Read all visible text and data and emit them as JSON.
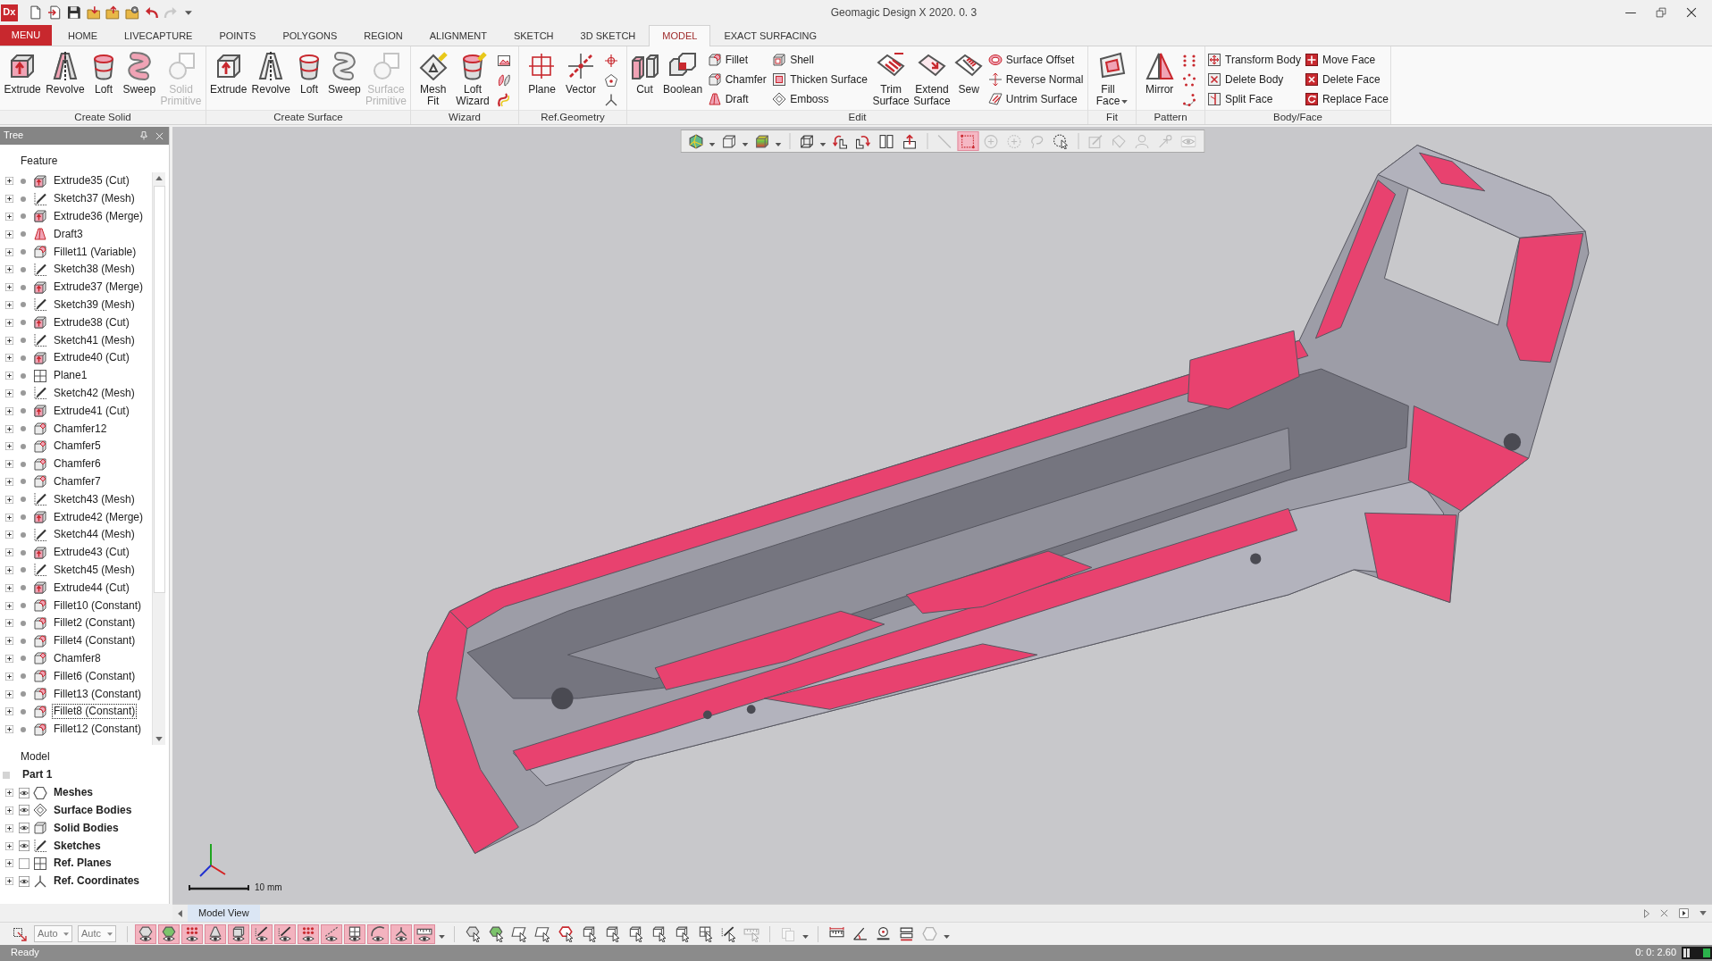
{
  "window": {
    "title": "Geomagic Design X 2020. 0. 3"
  },
  "app_logo": "Dx",
  "quick_access": [
    {
      "disabled": false
    },
    {
      "disabled": false
    },
    {
      "disabled": false
    },
    {
      "disabled": false
    },
    {
      "disabled": false
    },
    {
      "disabled": false
    },
    {
      "disabled": false
    },
    {
      "disabled": true
    }
  ],
  "menu_button": {
    "label": "MENU"
  },
  "tabs": [
    {
      "label": "HOME",
      "selected": false
    },
    {
      "label": "LIVECAPTURE",
      "selected": false
    },
    {
      "label": "POINTS",
      "selected": false
    },
    {
      "label": "POLYGONS",
      "selected": false
    },
    {
      "label": "REGION",
      "selected": false
    },
    {
      "label": "ALIGNMENT",
      "selected": false
    },
    {
      "label": "SKETCH",
      "selected": false
    },
    {
      "label": "3D SKETCH",
      "selected": false
    },
    {
      "label": "MODEL",
      "selected": true
    },
    {
      "label": "EXACT SURFACING",
      "selected": false
    }
  ],
  "ribbon": {
    "groups": [
      {
        "title": "Create Solid",
        "tools": [
          {
            "kind": "large",
            "label": "Extrude",
            "disabled": false
          },
          {
            "kind": "large",
            "label": "Revolve",
            "disabled": false
          },
          {
            "kind": "large",
            "label": "Loft",
            "disabled": false
          },
          {
            "kind": "large",
            "label": "Sweep",
            "disabled": false
          },
          {
            "kind": "large",
            "label": "Solid Primitive",
            "disabled": true
          }
        ]
      },
      {
        "title": "Create Surface",
        "tools": [
          {
            "kind": "large",
            "label": "Extrude",
            "disabled": false
          },
          {
            "kind": "large",
            "label": "Revolve",
            "disabled": false
          },
          {
            "kind": "large",
            "label": "Loft",
            "disabled": false
          },
          {
            "kind": "large",
            "label": "Sweep",
            "disabled": false
          },
          {
            "kind": "large",
            "label": "Surface Primitive",
            "disabled": true
          }
        ]
      },
      {
        "title": "Wizard",
        "tools": [
          {
            "kind": "large",
            "label": "Mesh Fit",
            "disabled": false
          },
          {
            "kind": "large",
            "label": "Loft Wizard",
            "disabled": false
          },
          {
            "kind": "icon_stack"
          }
        ]
      },
      {
        "title": "Ref.Geometry",
        "tools": [
          {
            "kind": "large",
            "label": "Plane",
            "disabled": false
          },
          {
            "kind": "large",
            "label": "Vector",
            "disabled": false
          },
          {
            "kind": "icon_stack"
          }
        ]
      },
      {
        "title": "Edit",
        "tools": [
          {
            "kind": "large",
            "label": "Cut",
            "disabled": false
          },
          {
            "kind": "large",
            "label": "Boolean",
            "disabled": false
          },
          {
            "kind": "small_column",
            "items": [
              {
                "label": "Fillet"
              },
              {
                "label": "Chamfer"
              },
              {
                "label": "Draft"
              }
            ]
          },
          {
            "kind": "small_column",
            "items": [
              {
                "label": "Shell"
              },
              {
                "label": "Thicken Surface"
              },
              {
                "label": "Emboss"
              }
            ]
          },
          {
            "kind": "large",
            "label": "Trim Surface",
            "disabled": false
          },
          {
            "kind": "large",
            "label": "Extend Surface",
            "disabled": false
          },
          {
            "kind": "large",
            "label": "Sew",
            "disabled": false
          },
          {
            "kind": "small_column",
            "items": [
              {
                "label": "Surface Offset"
              },
              {
                "label": "Reverse Normal"
              },
              {
                "label": "Untrim Surface"
              }
            ]
          }
        ]
      },
      {
        "title": "Fit",
        "tools": [
          {
            "kind": "large",
            "label": "Fill Face",
            "disabled": false,
            "dropdown": true
          }
        ]
      },
      {
        "title": "Pattern",
        "tools": [
          {
            "kind": "large",
            "label": "Mirror",
            "disabled": false
          },
          {
            "kind": "icon_stack"
          }
        ]
      },
      {
        "title": "Body/Face",
        "tools": [
          {
            "kind": "small_column",
            "items": [
              {
                "label": "Transform Body"
              },
              {
                "label": "Delete Body"
              },
              {
                "label": "Split Face"
              }
            ]
          },
          {
            "kind": "small_column",
            "items": [
              {
                "label": "Move Face"
              },
              {
                "label": "Delete Face"
              },
              {
                "label": "Replace Face"
              }
            ]
          }
        ]
      }
    ]
  },
  "tree_panel": {
    "title": "Tree",
    "features_heading": "Feature",
    "features": [
      {
        "kind": "extrude",
        "label": "Extrude35 (Cut)",
        "expanded": false,
        "selected": false
      },
      {
        "kind": "sketch",
        "label": "Sketch37 (Mesh)",
        "expanded": false,
        "selected": false
      },
      {
        "kind": "extrude",
        "label": "Extrude36 (Merge)",
        "expanded": false,
        "selected": false
      },
      {
        "kind": "draft",
        "label": "Draft3",
        "expanded": false,
        "selected": false
      },
      {
        "kind": "fillet",
        "label": "Fillet11 (Variable)",
        "expanded": false,
        "selected": false
      },
      {
        "kind": "sketch",
        "label": "Sketch38 (Mesh)",
        "expanded": false,
        "selected": false
      },
      {
        "kind": "extrude",
        "label": "Extrude37 (Merge)",
        "expanded": false,
        "selected": false
      },
      {
        "kind": "sketch",
        "label": "Sketch39 (Mesh)",
        "expanded": false,
        "selected": false
      },
      {
        "kind": "extrude",
        "label": "Extrude38 (Cut)",
        "expanded": false,
        "selected": false
      },
      {
        "kind": "sketch",
        "label": "Sketch41 (Mesh)",
        "expanded": false,
        "selected": false
      },
      {
        "kind": "extrude",
        "label": "Extrude40 (Cut)",
        "expanded": false,
        "selected": false
      },
      {
        "kind": "plane",
        "label": "Plane1",
        "expanded": false,
        "selected": false
      },
      {
        "kind": "sketch",
        "label": "Sketch42 (Mesh)",
        "expanded": false,
        "selected": false
      },
      {
        "kind": "extrude",
        "label": "Extrude41 (Cut)",
        "expanded": false,
        "selected": false
      },
      {
        "kind": "chamfer",
        "label": "Chamfer12",
        "expanded": false,
        "selected": false
      },
      {
        "kind": "chamfer",
        "label": "Chamfer5",
        "expanded": false,
        "selected": false
      },
      {
        "kind": "chamfer",
        "label": "Chamfer6",
        "expanded": false,
        "selected": false
      },
      {
        "kind": "chamfer",
        "label": "Chamfer7",
        "expanded": false,
        "selected": false
      },
      {
        "kind": "sketch",
        "label": "Sketch43 (Mesh)",
        "expanded": false,
        "selected": false
      },
      {
        "kind": "extrude",
        "label": "Extrude42 (Merge)",
        "expanded": false,
        "selected": false
      },
      {
        "kind": "sketch",
        "label": "Sketch44 (Mesh)",
        "expanded": false,
        "selected": false
      },
      {
        "kind": "extrude",
        "label": "Extrude43 (Cut)",
        "expanded": false,
        "selected": false
      },
      {
        "kind": "sketch",
        "label": "Sketch45 (Mesh)",
        "expanded": false,
        "selected": false
      },
      {
        "kind": "extrude",
        "label": "Extrude44 (Cut)",
        "expanded": false,
        "selected": false
      },
      {
        "kind": "fillet",
        "label": "Fillet10 (Constant)",
        "expanded": false,
        "selected": false
      },
      {
        "kind": "fillet",
        "label": "Fillet2 (Constant)",
        "expanded": false,
        "selected": false
      },
      {
        "kind": "fillet",
        "label": "Fillet4 (Constant)",
        "expanded": false,
        "selected": false
      },
      {
        "kind": "chamfer",
        "label": "Chamfer8",
        "expanded": false,
        "selected": false
      },
      {
        "kind": "fillet",
        "label": "Fillet6 (Constant)",
        "expanded": false,
        "selected": false
      },
      {
        "kind": "fillet",
        "label": "Fillet13 (Constant)",
        "expanded": false,
        "selected": false
      },
      {
        "kind": "fillet",
        "label": "Fillet8 (Constant)",
        "expanded": false,
        "selected": true
      },
      {
        "kind": "fillet",
        "label": "Fillet12 (Constant)",
        "expanded": false,
        "selected": false
      }
    ],
    "model_heading": "Model",
    "model_root": {
      "label": "Part 1",
      "children": [
        {
          "kind": "meshes",
          "label": "Meshes",
          "visible": true,
          "expanded": false
        },
        {
          "kind": "surface_bodies",
          "label": "Surface Bodies",
          "visible": true,
          "expanded": false
        },
        {
          "kind": "solid_bodies",
          "label": "Solid Bodies",
          "visible": true,
          "expanded": false
        },
        {
          "kind": "sketches",
          "label": "Sketches",
          "visible": true,
          "expanded": false
        },
        {
          "kind": "ref_planes",
          "label": "Ref. Planes",
          "visible": false,
          "expanded": false
        },
        {
          "kind": "ref_coordinates",
          "label": "Ref. Coordinates",
          "visible": true,
          "expanded": false
        }
      ]
    }
  },
  "viewport": {
    "tools": [
      {
        "on": false,
        "disabled": false,
        "dropdown": true
      },
      {
        "on": false,
        "disabled": false,
        "dropdown": true
      },
      {
        "on": false,
        "disabled": false,
        "dropdown": true
      },
      {
        "on": false,
        "disabled": false,
        "dropdown": true
      },
      {
        "on": false,
        "disabled": false
      },
      {
        "on": false,
        "disabled": false
      },
      {
        "on": false,
        "disabled": false
      },
      {
        "on": false,
        "disabled": false
      },
      {
        "on": false,
        "disabled": true
      },
      {
        "on": true,
        "disabled": false
      },
      {
        "on": false,
        "disabled": true
      },
      {
        "on": false,
        "disabled": true
      },
      {
        "on": false,
        "disabled": true
      },
      {
        "on": false,
        "disabled": false
      },
      {
        "on": false,
        "disabled": true
      },
      {
        "on": false,
        "disabled": true
      },
      {
        "on": false,
        "disabled": true
      },
      {
        "on": false,
        "disabled": true
      },
      {
        "on": false,
        "disabled": true
      }
    ],
    "scale_label": "10 mm"
  },
  "view_tabs": [
    {
      "label": "Model View",
      "selected": true
    }
  ],
  "bottom_toolbar": {
    "selection_fields": [
      {
        "value": "Auto"
      },
      {
        "value": "Autc"
      }
    ],
    "filters": [
      {
        "on": true
      },
      {
        "on": true
      },
      {
        "on": true
      },
      {
        "on": true
      },
      {
        "on": true
      },
      {
        "on": true
      },
      {
        "on": true
      },
      {
        "on": true
      },
      {
        "on": true
      },
      {
        "on": true
      },
      {
        "on": true
      },
      {
        "on": true
      },
      {
        "on": true
      }
    ],
    "select_tools": [
      {
        "disabled": false
      },
      {
        "disabled": false
      },
      {
        "disabled": false
      },
      {
        "disabled": false
      },
      {
        "disabled": false
      },
      {
        "disabled": false
      },
      {
        "disabled": false
      },
      {
        "disabled": false
      },
      {
        "disabled": false
      },
      {
        "disabled": false
      },
      {
        "disabled": false
      },
      {
        "disabled": false
      },
      {
        "disabled": true
      }
    ],
    "document_tool": {
      "disabled": true,
      "dropdown": true
    },
    "measure_tools": [
      {
        "disabled": false
      },
      {
        "disabled": false
      },
      {
        "disabled": false
      },
      {
        "disabled": false
      },
      {
        "disabled": true,
        "dropdown": true
      }
    ]
  },
  "status_bar": {
    "message": "Ready",
    "readout": "0: 0: 2.60"
  }
}
